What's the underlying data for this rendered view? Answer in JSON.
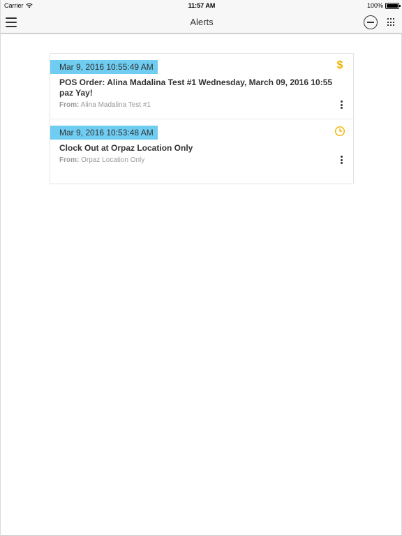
{
  "status_bar": {
    "carrier": "Carrier",
    "time": "11:57 AM",
    "battery": "100%",
    "battery_level": 1.0
  },
  "nav": {
    "title": "Alerts",
    "menu_icon": "hamburger-menu-icon",
    "remove_icon": "minus-circle-icon",
    "apps_icon": "grid-dots-icon"
  },
  "alerts": [
    {
      "date": "Mar 9, 2016 10:55:49 AM",
      "title": "POS Order: Alina Madalina Test #1 Wednesday, March 09, 2016 10:55 paz Yay!",
      "from_label": "From:",
      "from": "Alina Madalina Test #1",
      "type_icon": "dollar-icon",
      "type_glyph": "$"
    },
    {
      "date": "Mar 9, 2016 10:53:48 AM",
      "title": "Clock Out at Orpaz Location Only",
      "from_label": "From:",
      "from": "Orpaz Location Only",
      "type_icon": "clock-icon"
    }
  ],
  "colors": {
    "date_highlight": "#6fcdf2",
    "icon_accent": "#f0b400"
  }
}
